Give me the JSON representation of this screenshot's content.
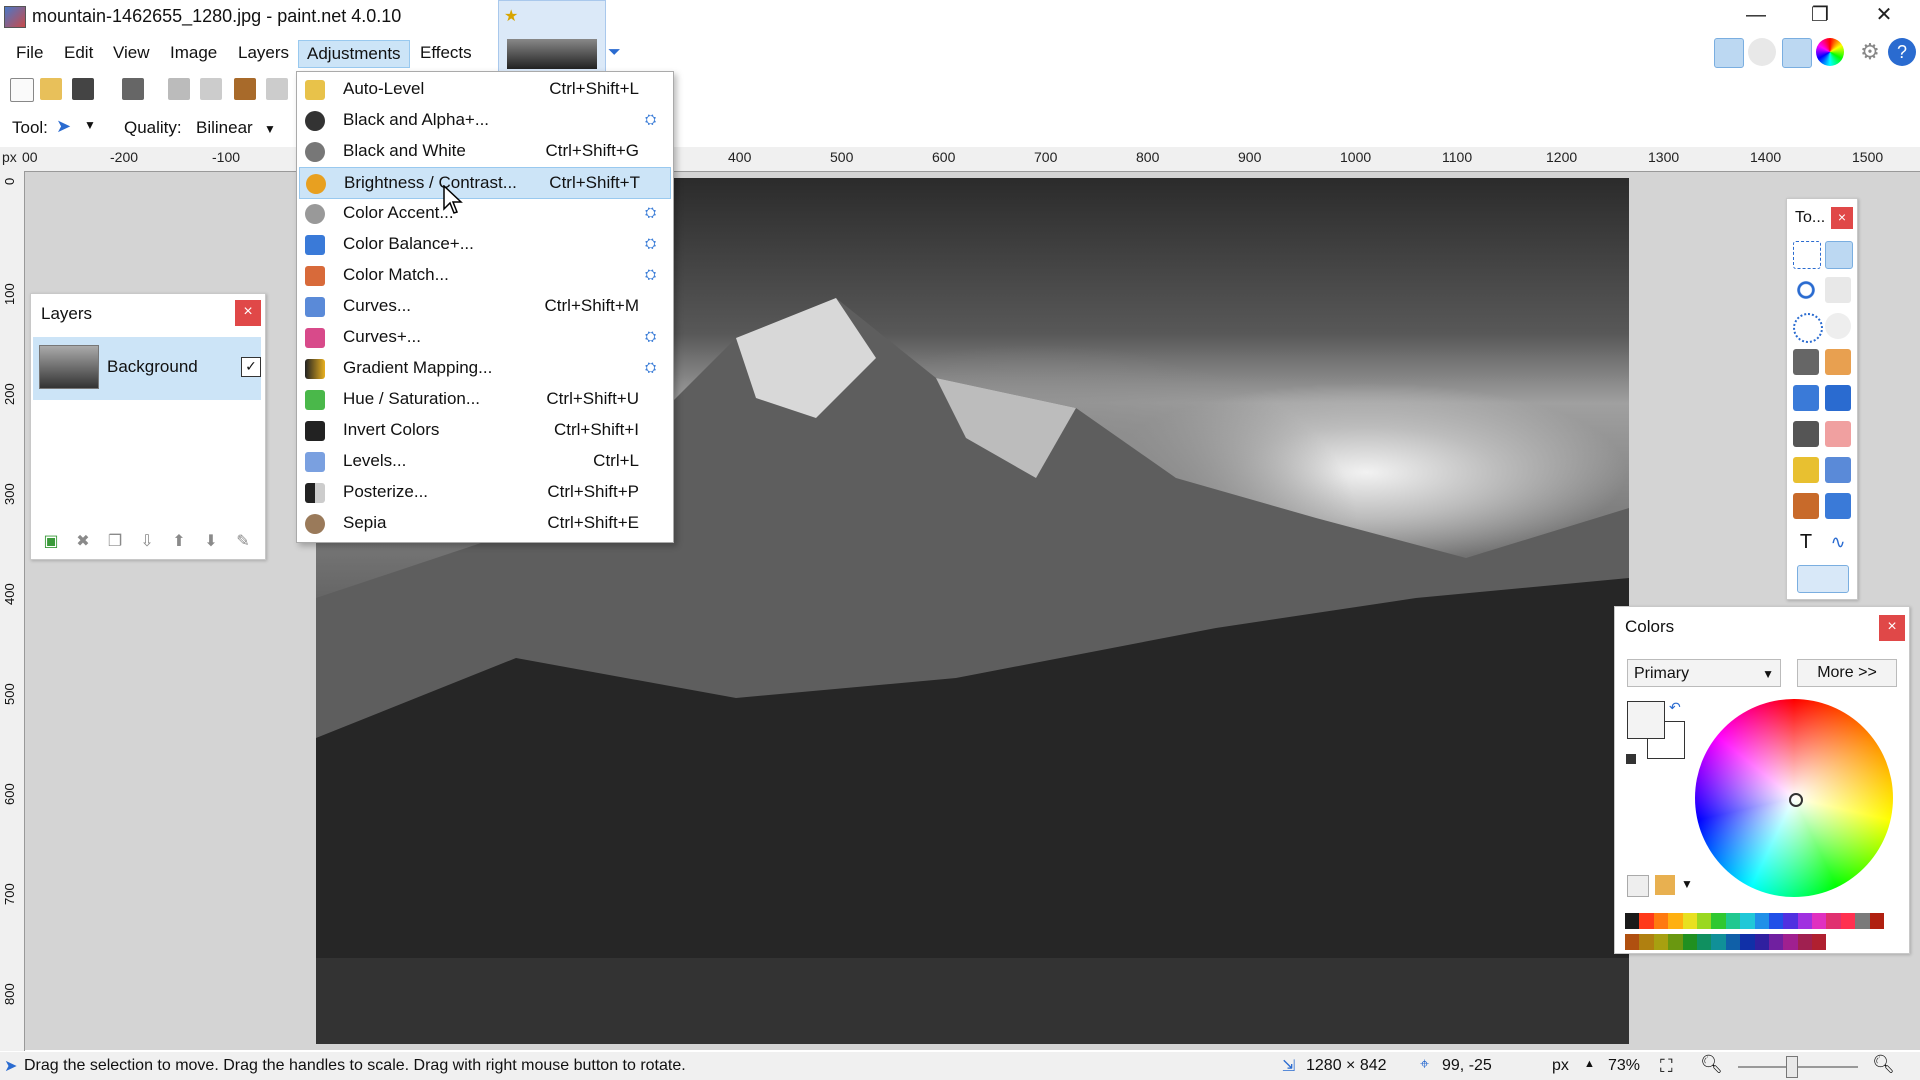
{
  "window": {
    "title": "mountain-1462655_1280.jpg - paint.net 4.0.10",
    "minimize": "—",
    "restore": "❐",
    "close": "✕"
  },
  "menubar": {
    "items": [
      "File",
      "Edit",
      "View",
      "Image",
      "Layers",
      "Adjustments",
      "Effects"
    ],
    "active": "Adjustments"
  },
  "toolbar": {
    "tool_label": "Tool:",
    "quality_label": "Quality:",
    "quality_value": "Bilinear"
  },
  "ruler": {
    "unit": "px",
    "top_labels": [
      "00",
      "-200",
      "-100",
      "400",
      "500",
      "600",
      "700",
      "800",
      "900",
      "1000",
      "1100",
      "1200",
      "1300",
      "1400",
      "1500"
    ],
    "left_labels": [
      "0",
      "100",
      "200",
      "300",
      "400",
      "500",
      "600",
      "700",
      "800"
    ]
  },
  "adjustments_menu": [
    {
      "label": "Auto-Level",
      "shortcut": "Ctrl+Shift+L",
      "plugin": false,
      "color": "#e8c24a"
    },
    {
      "label": "Black and Alpha+...",
      "shortcut": "",
      "plugin": true,
      "color": "#333333"
    },
    {
      "label": "Black and White",
      "shortcut": "Ctrl+Shift+G",
      "plugin": false,
      "color": "#777777"
    },
    {
      "label": "Brightness / Contrast...",
      "shortcut": "Ctrl+Shift+T",
      "plugin": false,
      "color": "#e8a020",
      "highlighted": true
    },
    {
      "label": "Color Accent...",
      "shortcut": "",
      "plugin": true,
      "color": "#999999"
    },
    {
      "label": "Color Balance+...",
      "shortcut": "",
      "plugin": true,
      "color": "#3a7ad8"
    },
    {
      "label": "Color Match...",
      "shortcut": "",
      "plugin": true,
      "color": "#d86a3a"
    },
    {
      "label": "Curves...",
      "shortcut": "Ctrl+Shift+M",
      "plugin": false,
      "color": "#5a8ad8"
    },
    {
      "label": "Curves+...",
      "shortcut": "",
      "plugin": true,
      "color": "#d84a8a"
    },
    {
      "label": "Gradient Mapping...",
      "shortcut": "",
      "plugin": true,
      "color": "#e8b020"
    },
    {
      "label": "Hue / Saturation...",
      "shortcut": "Ctrl+Shift+U",
      "plugin": false,
      "color": "#4ab84a"
    },
    {
      "label": "Invert Colors",
      "shortcut": "Ctrl+Shift+I",
      "plugin": false,
      "color": "#222222"
    },
    {
      "label": "Levels...",
      "shortcut": "Ctrl+L",
      "plugin": false,
      "color": "#7aa0e0"
    },
    {
      "label": "Posterize...",
      "shortcut": "Ctrl+Shift+P",
      "plugin": false,
      "color": "#555555"
    },
    {
      "label": "Sepia",
      "shortcut": "Ctrl+Shift+E",
      "plugin": false,
      "color": "#9a7a5a"
    }
  ],
  "layers_panel": {
    "title": "Layers",
    "close": "×",
    "layer_name": "Background",
    "layer_visible": "✓",
    "buttons": [
      "add-layer-icon",
      "delete-layer-icon",
      "duplicate-layer-icon",
      "merge-down-icon",
      "move-up-icon",
      "move-down-icon",
      "layer-properties-icon"
    ]
  },
  "tools_panel": {
    "title": "To...",
    "close": "×"
  },
  "colors_panel": {
    "title": "Colors",
    "close": "×",
    "select_value": "Primary",
    "more_label": "More >>",
    "palette": [
      "#1a1a1a",
      "#ff3a1a",
      "#ff7a10",
      "#ffb010",
      "#e8e020",
      "#9ad820",
      "#30c830",
      "#20c890",
      "#20c8d8",
      "#2090e8",
      "#2050e8",
      "#5030e0",
      "#a030e0",
      "#e030c0",
      "#e03070",
      "#ff3050",
      "#7a7a7a",
      "#b02010",
      "#b05010",
      "#b08010",
      "#a8a010",
      "#6a9810",
      "#209020",
      "#109060",
      "#109098",
      "#1060a8",
      "#1030a8",
      "#3020a0",
      "#7020a0",
      "#a02090",
      "#a02050",
      "#b02030"
    ]
  },
  "statusbar": {
    "hint": "Drag the selection to move. Drag the handles to scale. Drag with right mouse button to rotate.",
    "size": "1280 × 842",
    "position": "99, -25",
    "unit": "px",
    "zoom": "73%"
  },
  "colors": {
    "highlight": "#cce4f7",
    "highlight_border": "#99c9ef",
    "close_red": "#e04848"
  }
}
